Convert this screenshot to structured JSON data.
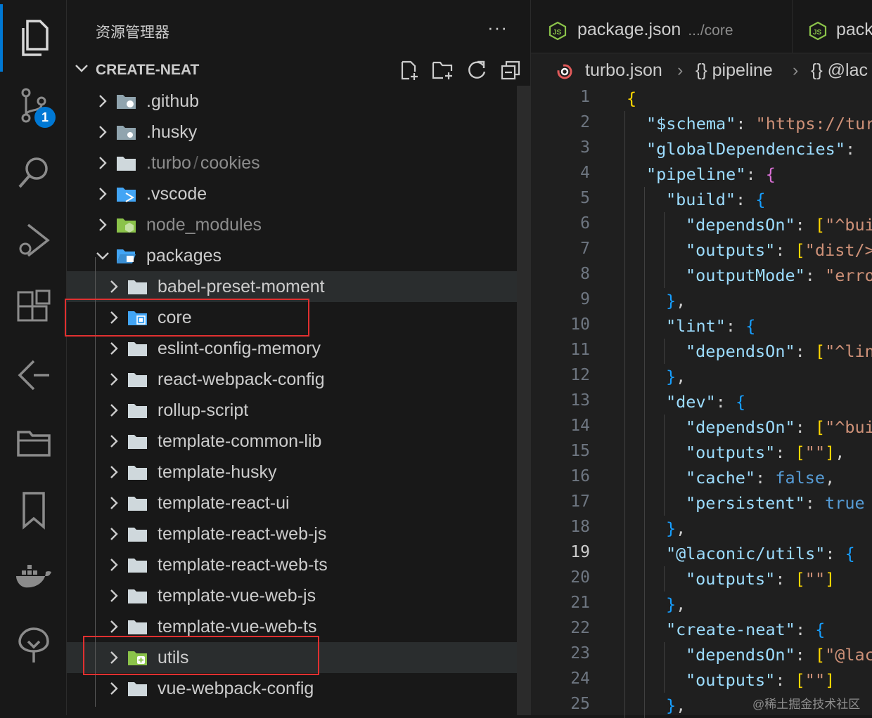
{
  "activity_bar": {
    "items": [
      "files-icon",
      "source-control-icon",
      "search-icon",
      "run-debug-icon",
      "extensions-icon",
      "remote-explorer-icon",
      "folder-icon",
      "bookmark-icon",
      "docker-icon",
      "tree-icon"
    ],
    "source_control_badge": "1"
  },
  "sidebar": {
    "title": "资源管理器",
    "more": "···",
    "workspace": "CREATE-NEAT",
    "actions": [
      "new-file-icon",
      "new-folder-icon",
      "refresh-icon",
      "collapse-all-icon"
    ],
    "tree": [
      {
        "label": ".github",
        "level": 0,
        "icon": "github-folder-icon",
        "expanded": false
      },
      {
        "label": ".husky",
        "level": 0,
        "icon": "husky-folder-icon",
        "expanded": false
      },
      {
        "label": ".turbo",
        "suffix": "cookies",
        "level": 0,
        "icon": "folder-icon",
        "expanded": false,
        "dim": true
      },
      {
        "label": ".vscode",
        "level": 0,
        "icon": "vscode-folder-icon",
        "expanded": false
      },
      {
        "label": "node_modules",
        "level": 0,
        "icon": "node-folder-icon",
        "expanded": false,
        "dim": true
      },
      {
        "label": "packages",
        "level": 0,
        "icon": "packages-folder-icon",
        "expanded": true
      },
      {
        "label": "babel-preset-moment",
        "level": 1,
        "icon": "folder-icon",
        "expanded": false,
        "hl": true
      },
      {
        "label": "core",
        "level": 1,
        "icon": "core-folder-icon",
        "expanded": false
      },
      {
        "label": "eslint-config-memory",
        "level": 1,
        "icon": "folder-icon",
        "expanded": false
      },
      {
        "label": "react-webpack-config",
        "level": 1,
        "icon": "folder-icon",
        "expanded": false
      },
      {
        "label": "rollup-script",
        "level": 1,
        "icon": "folder-icon",
        "expanded": false
      },
      {
        "label": "template-common-lib",
        "level": 1,
        "icon": "folder-icon",
        "expanded": false
      },
      {
        "label": "template-husky",
        "level": 1,
        "icon": "folder-icon",
        "expanded": false
      },
      {
        "label": "template-react-ui",
        "level": 1,
        "icon": "folder-icon",
        "expanded": false
      },
      {
        "label": "template-react-web-js",
        "level": 1,
        "icon": "folder-icon",
        "expanded": false
      },
      {
        "label": "template-react-web-ts",
        "level": 1,
        "icon": "folder-icon",
        "expanded": false
      },
      {
        "label": "template-vue-web-js",
        "level": 1,
        "icon": "folder-icon",
        "expanded": false
      },
      {
        "label": "template-vue-web-ts",
        "level": 1,
        "icon": "folder-icon",
        "expanded": false
      },
      {
        "label": "utils",
        "level": 1,
        "icon": "utils-folder-icon",
        "expanded": false,
        "hl": true
      },
      {
        "label": "vue-webpack-config",
        "level": 1,
        "icon": "folder-icon",
        "expanded": false
      }
    ]
  },
  "editor": {
    "tabs": [
      {
        "name": "package.json",
        "desc": ".../core"
      },
      {
        "name": "pack",
        "desc": ""
      }
    ],
    "breadcrumb": [
      "turbo.json",
      "{} pipeline",
      "{} @lac"
    ],
    "current_line": 19,
    "lines": [
      {
        "n": "1",
        "d": 0,
        "t": [
          [
            "b1",
            "{"
          ]
        ]
      },
      {
        "n": "2",
        "d": 1,
        "t": [
          [
            "k",
            "\"$schema\""
          ],
          [
            "p",
            ": "
          ],
          [
            "s",
            "\"https://tur"
          ]
        ]
      },
      {
        "n": "3",
        "d": 1,
        "t": [
          [
            "k",
            "\"globalDependencies\""
          ],
          [
            "p",
            ":"
          ]
        ]
      },
      {
        "n": "4",
        "d": 1,
        "t": [
          [
            "k",
            "\"pipeline\""
          ],
          [
            "p",
            ": "
          ],
          [
            "b2",
            "{"
          ]
        ]
      },
      {
        "n": "5",
        "d": 2,
        "t": [
          [
            "k",
            "\"build\""
          ],
          [
            "p",
            ": "
          ],
          [
            "b3",
            "{"
          ]
        ]
      },
      {
        "n": "6",
        "d": 3,
        "t": [
          [
            "k",
            "\"dependsOn\""
          ],
          [
            "p",
            ": "
          ],
          [
            "b1",
            "["
          ],
          [
            "s",
            "\"^bui"
          ]
        ]
      },
      {
        "n": "7",
        "d": 3,
        "t": [
          [
            "k",
            "\"outputs\""
          ],
          [
            "p",
            ": "
          ],
          [
            "b1",
            "["
          ],
          [
            "s",
            "\"dist/>"
          ]
        ]
      },
      {
        "n": "8",
        "d": 3,
        "t": [
          [
            "k",
            "\"outputMode\""
          ],
          [
            "p",
            ": "
          ],
          [
            "s",
            "\"erro"
          ]
        ]
      },
      {
        "n": "9",
        "d": 2,
        "t": [
          [
            "b3",
            "}"
          ],
          [
            "p",
            ","
          ]
        ]
      },
      {
        "n": "10",
        "d": 2,
        "t": [
          [
            "k",
            "\"lint\""
          ],
          [
            "p",
            ": "
          ],
          [
            "b3",
            "{"
          ]
        ]
      },
      {
        "n": "11",
        "d": 3,
        "t": [
          [
            "k",
            "\"dependsOn\""
          ],
          [
            "p",
            ": "
          ],
          [
            "b1",
            "["
          ],
          [
            "s",
            "\"^lin"
          ]
        ]
      },
      {
        "n": "12",
        "d": 2,
        "t": [
          [
            "b3",
            "}"
          ],
          [
            "p",
            ","
          ]
        ]
      },
      {
        "n": "13",
        "d": 2,
        "t": [
          [
            "k",
            "\"dev\""
          ],
          [
            "p",
            ": "
          ],
          [
            "b3",
            "{"
          ]
        ]
      },
      {
        "n": "14",
        "d": 3,
        "t": [
          [
            "k",
            "\"dependsOn\""
          ],
          [
            "p",
            ": "
          ],
          [
            "b1",
            "["
          ],
          [
            "s",
            "\"^bui"
          ]
        ]
      },
      {
        "n": "15",
        "d": 3,
        "t": [
          [
            "k",
            "\"outputs\""
          ],
          [
            "p",
            ": "
          ],
          [
            "b1",
            "["
          ],
          [
            "s",
            "\"\""
          ],
          [
            "b1",
            "]"
          ],
          [
            "p",
            ","
          ]
        ]
      },
      {
        "n": "16",
        "d": 3,
        "t": [
          [
            "k",
            "\"cache\""
          ],
          [
            "p",
            ": "
          ],
          [
            "kw",
            "false"
          ],
          [
            "p",
            ","
          ]
        ]
      },
      {
        "n": "17",
        "d": 3,
        "t": [
          [
            "k",
            "\"persistent\""
          ],
          [
            "p",
            ": "
          ],
          [
            "kw",
            "true"
          ]
        ]
      },
      {
        "n": "18",
        "d": 2,
        "t": [
          [
            "b3",
            "}"
          ],
          [
            "p",
            ","
          ]
        ]
      },
      {
        "n": "19",
        "d": 2,
        "t": [
          [
            "k",
            "\"@laconic/utils\""
          ],
          [
            "p",
            ": "
          ],
          [
            "b3",
            "{"
          ]
        ]
      },
      {
        "n": "20",
        "d": 3,
        "t": [
          [
            "k",
            "\"outputs\""
          ],
          [
            "p",
            ": "
          ],
          [
            "b1",
            "["
          ],
          [
            "s",
            "\"\""
          ],
          [
            "b1",
            "]"
          ]
        ]
      },
      {
        "n": "21",
        "d": 2,
        "t": [
          [
            "b3",
            "}"
          ],
          [
            "p",
            ","
          ]
        ]
      },
      {
        "n": "22",
        "d": 2,
        "t": [
          [
            "k",
            "\"create-neat\""
          ],
          [
            "p",
            ": "
          ],
          [
            "b3",
            "{"
          ]
        ]
      },
      {
        "n": "23",
        "d": 3,
        "t": [
          [
            "k",
            "\"dependsOn\""
          ],
          [
            "p",
            ": "
          ],
          [
            "b1",
            "["
          ],
          [
            "s",
            "\"@lac"
          ]
        ]
      },
      {
        "n": "24",
        "d": 3,
        "t": [
          [
            "k",
            "\"outputs\""
          ],
          [
            "p",
            ": "
          ],
          [
            "b1",
            "["
          ],
          [
            "s",
            "\"\""
          ],
          [
            "b1",
            "]"
          ]
        ]
      },
      {
        "n": "25",
        "d": 2,
        "t": [
          [
            "b3",
            "}"
          ],
          [
            "p",
            ","
          ]
        ]
      }
    ]
  },
  "watermark": "@稀土掘金技术社区"
}
